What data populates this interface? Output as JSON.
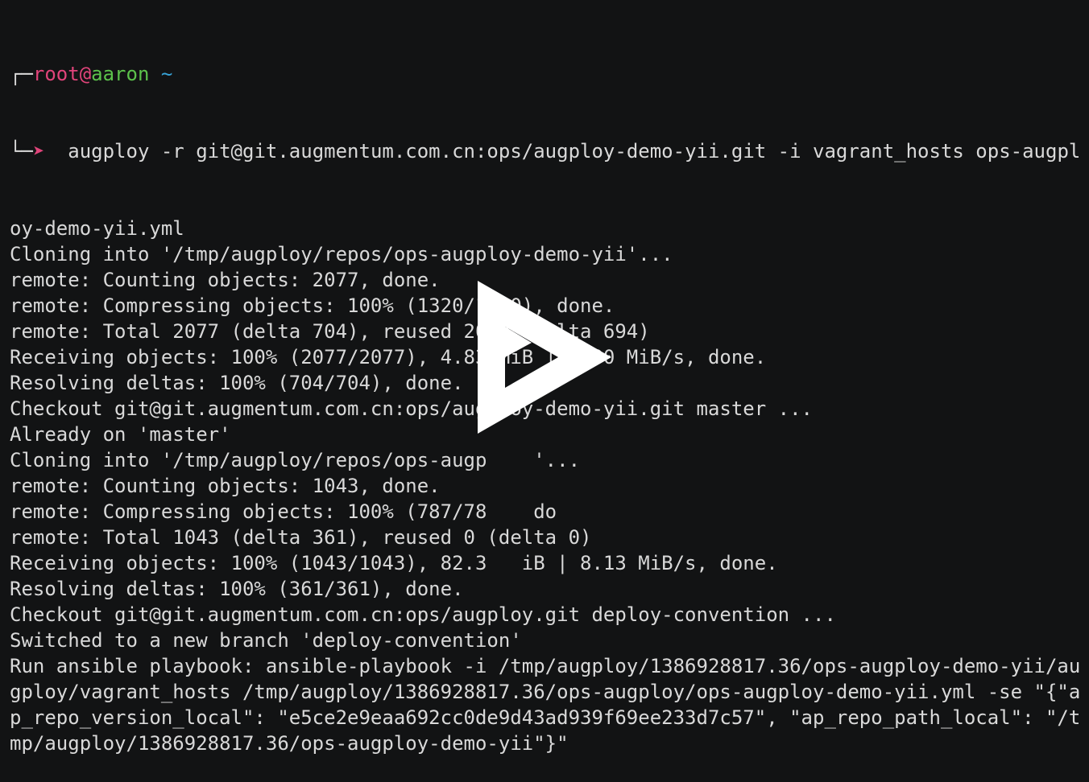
{
  "prompt": {
    "corner_top": "┌─",
    "user": "root",
    "at": "@",
    "host": "aaron",
    "tilde": "~",
    "corner_bottom": "└─",
    "arrow": "➤",
    "command": "  augploy -r git@git.augmentum.com.cn:ops/augploy-demo-yii.git -i vagrant_hosts ops-augpl"
  },
  "output_lines": [
    "oy-demo-yii.yml",
    "Cloning into '/tmp/augploy/repos/ops-augploy-demo-yii'...",
    "remote: Counting objects: 2077, done.",
    "remote: Compressing objects: 100% (1320/1320), done.",
    "remote: Total 2077 (delta 704), reused 2052 (delta 694)",
    "Receiving objects: 100% (2077/2077), 4.83 MiB | 9.00 MiB/s, done.",
    "Resolving deltas: 100% (704/704), done.",
    "Checkout git@git.augmentum.com.cn:ops/augploy-demo-yii.git master ...",
    "Already on 'master'",
    "Cloning into '/tmp/augploy/repos/ops-augp    '...",
    "remote: Counting objects: 1043, done.",
    "remote: Compressing objects: 100% (787/78    do",
    "remote: Total 1043 (delta 361), reused 0 (delta 0)",
    "Receiving objects: 100% (1043/1043), 82.3   iB | 8.13 MiB/s, done.",
    "Resolving deltas: 100% (361/361), done.",
    "Checkout git@git.augmentum.com.cn:ops/augploy.git deploy-convention ...",
    "Switched to a new branch 'deploy-convention'",
    "Run ansible playbook: ansible-playbook -i /tmp/augploy/1386928817.36/ops-augploy-demo-yii/au",
    "gploy/vagrant_hosts /tmp/augploy/1386928817.36/ops-augploy/ops-augploy-demo-yii.yml -se \"{\"a",
    "p_repo_version_local\": \"e5ce2e9eaa692cc0de9d43ad939f69ee233d7c57\", \"ap_repo_path_local\": \"/t",
    "mp/augploy/1386928817.36/ops-augploy-demo-yii\"}\""
  ],
  "overlay": {
    "icon": "play-icon",
    "color": "#ffffff"
  },
  "colors": {
    "background": "#121314",
    "foreground": "#d9d9d9",
    "user": "#e0447a",
    "host": "#5cc24b",
    "tilde": "#37a2d6"
  }
}
